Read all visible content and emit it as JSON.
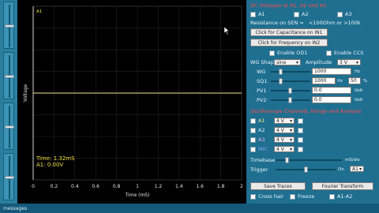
{
  "plot": {
    "ylabel": "Voltage",
    "xlabel": "Time (mS)",
    "xticks": [
      "0",
      "0.2",
      "0.4",
      "0.6",
      "0.8",
      "1",
      "1.2",
      "1.4",
      "1.6",
      "1.8",
      "2"
    ],
    "channel_marker": "A1",
    "readout_time": "Time:  1.32mS",
    "readout_a1": "A1:  0.00V",
    "trace_color": "#f0e68c",
    "cursor_color": "#ffffff"
  },
  "panel": {
    "dc_header": "DC Voltages at A1, A2 and A3",
    "dc_channels": [
      "A1",
      "A2",
      "A3"
    ],
    "resistance_label": "Resistance on SEN =",
    "resistance_value": "<100Ohm  or  >100k",
    "cap_button": "Click for Capacitance on IN1",
    "freq_button": "Click for Frequency on IN2",
    "enable_od1": "Enable OD1",
    "enable_ccs": "Enable CCS",
    "wg_shape_label": "WG Shape",
    "wg_shape_value": "sine",
    "amplitude_label": "Amplitude",
    "amplitude_value": "3 V",
    "wg_label": "WG",
    "wg_value": "1000",
    "wg_unit": "Hz",
    "sq1_label": "SQ1",
    "sq1_value": "1000",
    "sq1_unit": "Hz",
    "sq1_duty": "50",
    "sq1_duty_unit": "%",
    "pv1_label": "PV1",
    "pv1_value": "0.0",
    "pv1_unit": "Volt",
    "pv2_label": "PV2",
    "pv2_value": "0.0",
    "pv2_unit": "Volt",
    "scope_header": "Oscilloscope Channels, Range and Analysis",
    "channels": [
      {
        "name": "A1",
        "range": "4 V"
      },
      {
        "name": "A2",
        "range": "4 V"
      },
      {
        "name": "A3",
        "range": "4 V"
      },
      {
        "name": "MIC",
        "range": "4 V"
      }
    ],
    "timebase_label": "Timebase",
    "timebase_unit": "mS/div",
    "trigger_label": "Trigger",
    "trigger_on": "On",
    "trigger_channel": "A1",
    "save_button": "Save Traces",
    "fourier_button": "Fourier Transform",
    "crosshair": "Cross hair",
    "freeze": "Freeze",
    "a1a2": "A1-A2"
  },
  "status": {
    "text": "messages"
  }
}
